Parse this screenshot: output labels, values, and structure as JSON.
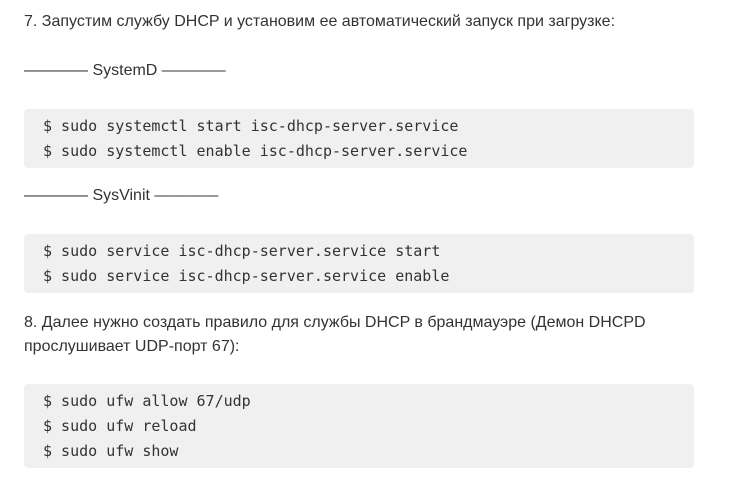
{
  "article": {
    "step7_text": "7. Запустим службу DHCP и установим ее автоматический запуск при загрузке:",
    "systemd_separator": "———— SystemD ————",
    "systemd_commands": [
      "$ sudo systemctl start isc-dhcp-server.service",
      "$ sudo systemctl enable isc-dhcp-server.service"
    ],
    "sysvinit_separator": "———— SysVinit ————",
    "sysvinit_commands": [
      "$ sudo service isc-dhcp-server.service start",
      "$ sudo service isc-dhcp-server.service enable"
    ],
    "step8_line1": "8. Далее нужно создать правило для службы DHCP в брандмауэре (Демон DHCPD",
    "step8_line2": "прослушивает UDP-порт 67):",
    "ufw_commands": [
      "$ sudo ufw allow 67/udp",
      "$ sudo ufw reload",
      "$ sudo ufw show"
    ]
  }
}
